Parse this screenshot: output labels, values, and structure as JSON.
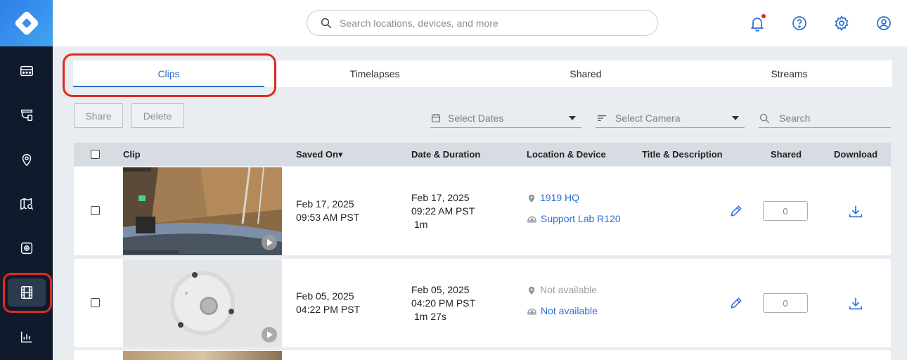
{
  "search": {
    "placeholder": "Search locations, devices, and more"
  },
  "sidebar": {
    "items": [
      "dashboard-icon",
      "camera-icon",
      "location-pin-icon",
      "map-search-icon",
      "device-icon",
      "film-icon",
      "chart-icon"
    ],
    "active": "film-icon"
  },
  "tabs": [
    {
      "label": "Clips",
      "active": true
    },
    {
      "label": "Timelapses",
      "active": false
    },
    {
      "label": "Shared",
      "active": false
    },
    {
      "label": "Streams",
      "active": false
    }
  ],
  "toolbar": {
    "share_label": "Share",
    "delete_label": "Delete",
    "dates_placeholder": "Select Dates",
    "camera_placeholder": "Select Camera",
    "search_placeholder": "Search"
  },
  "table": {
    "headers": {
      "clip": "Clip",
      "saved_on": "Saved On▾",
      "date_duration": "Date & Duration",
      "location_device": "Location & Device",
      "title_description": "Title & Description",
      "shared": "Shared",
      "download": "Download"
    },
    "rows": [
      {
        "saved_date": "Feb 17, 2025",
        "saved_time": "09:53 AM PST",
        "clip_date": "Feb 17, 2025",
        "clip_time": "09:22 AM PST",
        "duration": "1m",
        "location": "1919 HQ",
        "device": "Support Lab R120",
        "shared_count": "0"
      },
      {
        "saved_date": "Feb 05, 2025",
        "saved_time": "04:22 PM PST",
        "clip_date": "Feb 05, 2025",
        "clip_time": "04:20 PM PST",
        "duration": "1m 27s",
        "location": "Not available",
        "device": "Not available",
        "shared_count": "0"
      }
    ]
  },
  "colors": {
    "accent": "#2c6fd1",
    "sidebar": "#0f1b2d",
    "highlight": "#e02a1e",
    "notification": "#e02a1e"
  }
}
